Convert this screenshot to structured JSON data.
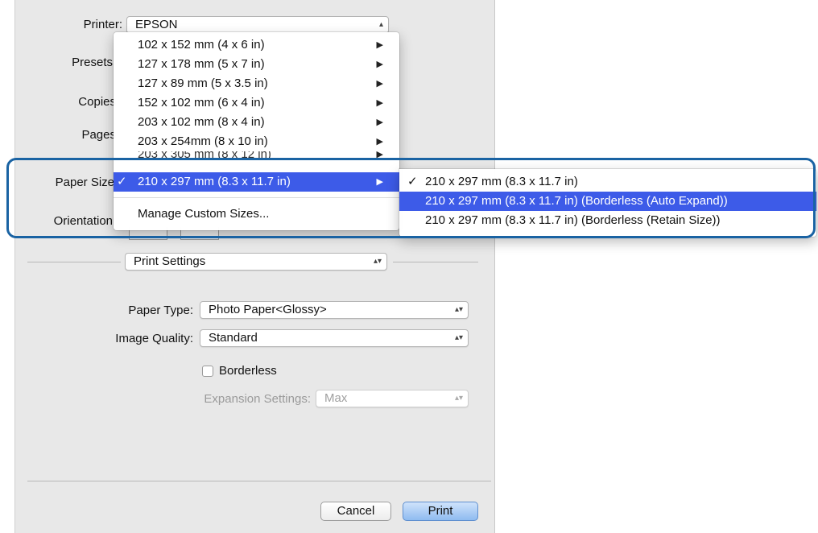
{
  "printer": {
    "label": "Printer:",
    "value": "EPSON"
  },
  "presets_label": "Presets",
  "copies_label": "Copies",
  "pages_label": "Pages",
  "paper_size_label": "Paper Size",
  "orientation_label": "Orientation",
  "paper_menu": {
    "items": [
      {
        "label": "102 x 152 mm (4 x 6 in)",
        "submenu": true
      },
      {
        "label": "127 x 178 mm (5 x 7 in)",
        "submenu": true
      },
      {
        "label": "127 x 89 mm (5 x 3.5 in)",
        "submenu": true
      },
      {
        "label": "152 x 102 mm (6 x 4 in)",
        "submenu": true
      },
      {
        "label": "203 x 102 mm (8 x 4 in)",
        "submenu": true
      },
      {
        "label": "203 x 254mm (8 x 10 in)",
        "submenu": true
      },
      {
        "label": "203 x 305 mm (8 x 12 in)",
        "submenu": true
      }
    ],
    "selected": {
      "label": "210 x 297 mm (8.3 x 11.7 in)",
      "check": "✓"
    },
    "manage": "Manage Custom Sizes..."
  },
  "submenu": {
    "items": [
      {
        "label": "210 x 297 mm (8.3 x 11.7 in)",
        "checked": true
      },
      {
        "label": "210 x 297 mm (8.3 x 11.7 in) (Borderless (Auto Expand))",
        "selected": true
      },
      {
        "label": "210 x 297 mm (8.3 x 11.7 in) (Borderless (Retain Size))"
      }
    ],
    "check": "✓"
  },
  "section_popup": "Print Settings",
  "paper_type": {
    "label": "Paper Type:",
    "value": "Photo Paper<Glossy>"
  },
  "image_quality": {
    "label": "Image Quality:",
    "value": "Standard"
  },
  "borderless": {
    "label": "Borderless",
    "checked": false
  },
  "expansion": {
    "label": "Expansion Settings:",
    "value": "Max"
  },
  "buttons": {
    "cancel": "Cancel",
    "print": "Print"
  },
  "icons": {
    "submenu_arrow": "▶",
    "popup_arrows": "⬍"
  },
  "colors": {
    "highlight": "#3d5be8",
    "callout": "#1a63a3"
  }
}
